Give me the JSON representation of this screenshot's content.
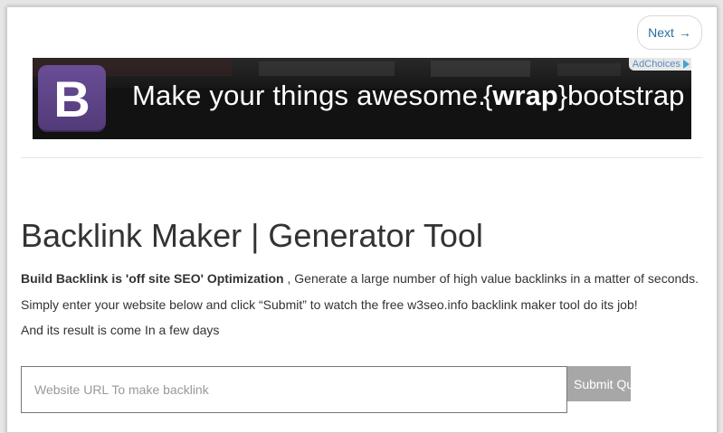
{
  "nav": {
    "next_label": "Next",
    "next_arrow": "→"
  },
  "ad": {
    "logo_letter": "B",
    "headline": "Make your things awesome.",
    "brand_prefix": "{",
    "brand_bold": "wrap",
    "brand_suffix": "}bootstrap",
    "adchoices_label": "AdChoices",
    "logo_color": "#5e4485"
  },
  "main": {
    "title": "Backlink Maker | Generator Tool",
    "intro_bold": "Build Backlink is 'off site SEO' Optimization",
    "intro_rest": " , Generate a large number of high value backlinks in a matter of seconds.",
    "line2": "Simply enter your website below and click “Submit” to watch the free w3seo.info backlink maker tool do its job!",
    "line3": "And its result is come In a few days"
  },
  "form": {
    "url_placeholder": "Website URL To make backlink",
    "submit_label": "Submit Query"
  },
  "colors": {
    "submit_bg": "#a7a7a7",
    "link_blue": "#2a6f9f"
  }
}
